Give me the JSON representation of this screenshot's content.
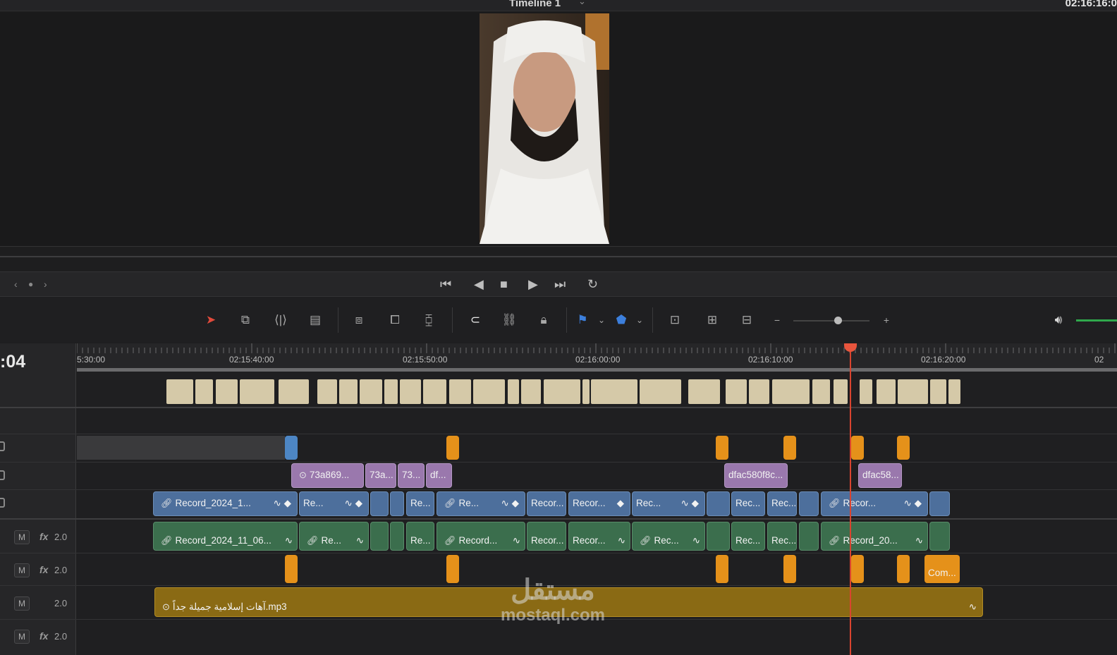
{
  "window": {
    "title": "Timeline 1",
    "timecode": "02:16:16:0"
  },
  "timeline": {
    "current_tc_partial": ":04",
    "ruler_labels": [
      "5:30:00",
      "02:15:40:00",
      "02:15:50:00",
      "02:16:00:00",
      "02:16:10:00",
      "02:16:20:00",
      "02"
    ],
    "v_clips_purple": [
      "73a869...",
      "73a...",
      "73...",
      "df...",
      "dfac580f8c...",
      "dfac58..."
    ],
    "v1_clips": [
      "Record_2024_1...",
      "Re...",
      "Re...",
      "Re...",
      "Recor...",
      "Recor...",
      "Rec...",
      "Rec...",
      "Rec...",
      "Recor..."
    ],
    "a1_clips": [
      "Record_2024_11_06...",
      "Re...",
      "Re...",
      "Record...",
      "Recor...",
      "Recor...",
      "Rec...",
      "Rec...",
      "Rec...",
      "Record_20..."
    ],
    "a2_clip_label": "Com...",
    "music_clip": "آهات إسلامية جميلة جداً.mp3",
    "tracks": [
      {
        "m": "M",
        "fx": "fx",
        "vol": "2.0"
      },
      {
        "m": "M",
        "fx": "fx",
        "vol": "2.0"
      },
      {
        "m": "M",
        "fx": "",
        "vol": "2.0"
      },
      {
        "m": "M",
        "fx": "fx",
        "vol": "2.0"
      }
    ]
  },
  "watermark": {
    "arabic": "مستقل",
    "latin": "mostaql.com"
  },
  "colors": {
    "playhead": "#d9442f",
    "blue_clip": "#4d6f9c",
    "green_clip": "#3b6e4d",
    "purple_clip": "#9a78ad",
    "orange_clip": "#e5911a"
  },
  "icons": [
    "skip-start-icon",
    "prev-frame-icon",
    "stop-icon",
    "play-icon",
    "skip-end-icon",
    "loop-icon",
    "selection-arrow-icon",
    "trim-icon",
    "dynamic-trim-icon",
    "blade-icon",
    "insert-icon",
    "overwrite-icon",
    "replace-icon",
    "snapping-icon",
    "linked-selection-icon",
    "position-lock-icon",
    "flag-icon",
    "marker-icon",
    "zoom-full-icon",
    "zoom-detail-icon",
    "zoom-custom-icon",
    "volume-icon"
  ]
}
